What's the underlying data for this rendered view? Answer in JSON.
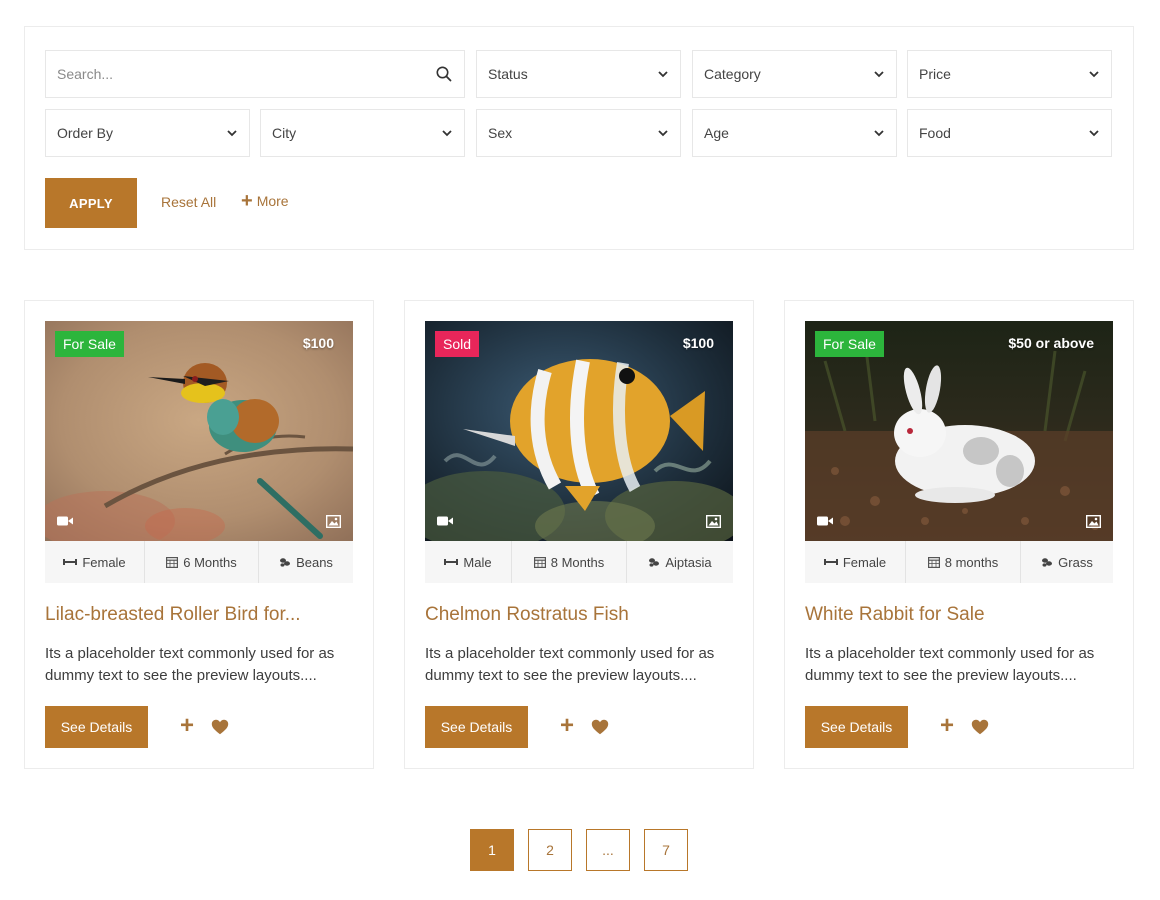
{
  "filters": {
    "search_placeholder": "Search...",
    "dropdowns_row1": [
      "Status",
      "Category",
      "Price"
    ],
    "dropdowns_row2": [
      "Order By",
      "City",
      "Sex",
      "Age",
      "Food"
    ],
    "apply_label": "APPLY",
    "reset_label": "Reset All",
    "more_label": "More"
  },
  "listings": [
    {
      "badge": "For Sale",
      "badge_color": "#2cb53c",
      "price": "$100",
      "sex": "Female",
      "age": "6 Months",
      "food": "Beans",
      "title": "Lilac-breasted Roller Bird for...",
      "description": "Its a placeholder text commonly used for as dummy text to see the preview layouts....",
      "details_label": "See Details",
      "image": "bird-on-branch"
    },
    {
      "badge": "Sold",
      "badge_color": "#e8265a",
      "price": "$100",
      "sex": "Male",
      "age": "8 Months",
      "food": "Aiptasia",
      "title": "Chelmon Rostratus Fish",
      "description": "Its a placeholder text commonly used for as dummy text to see the preview layouts....",
      "details_label": "See Details",
      "image": "butterfly-fish"
    },
    {
      "badge": "For Sale",
      "badge_color": "#2cb53c",
      "price": "$50 or above",
      "sex": "Female",
      "age": "8 months",
      "food": "Grass",
      "title": "White Rabbit for Sale",
      "description": "Its a placeholder text commonly used for as dummy text to see the preview layouts....",
      "details_label": "See Details",
      "image": "white-rabbit"
    }
  ],
  "pagination": {
    "pages": [
      "1",
      "2",
      "...",
      "7"
    ],
    "current": "1"
  },
  "colors": {
    "accent": "#b8772a",
    "accent_text": "#a8743a"
  }
}
